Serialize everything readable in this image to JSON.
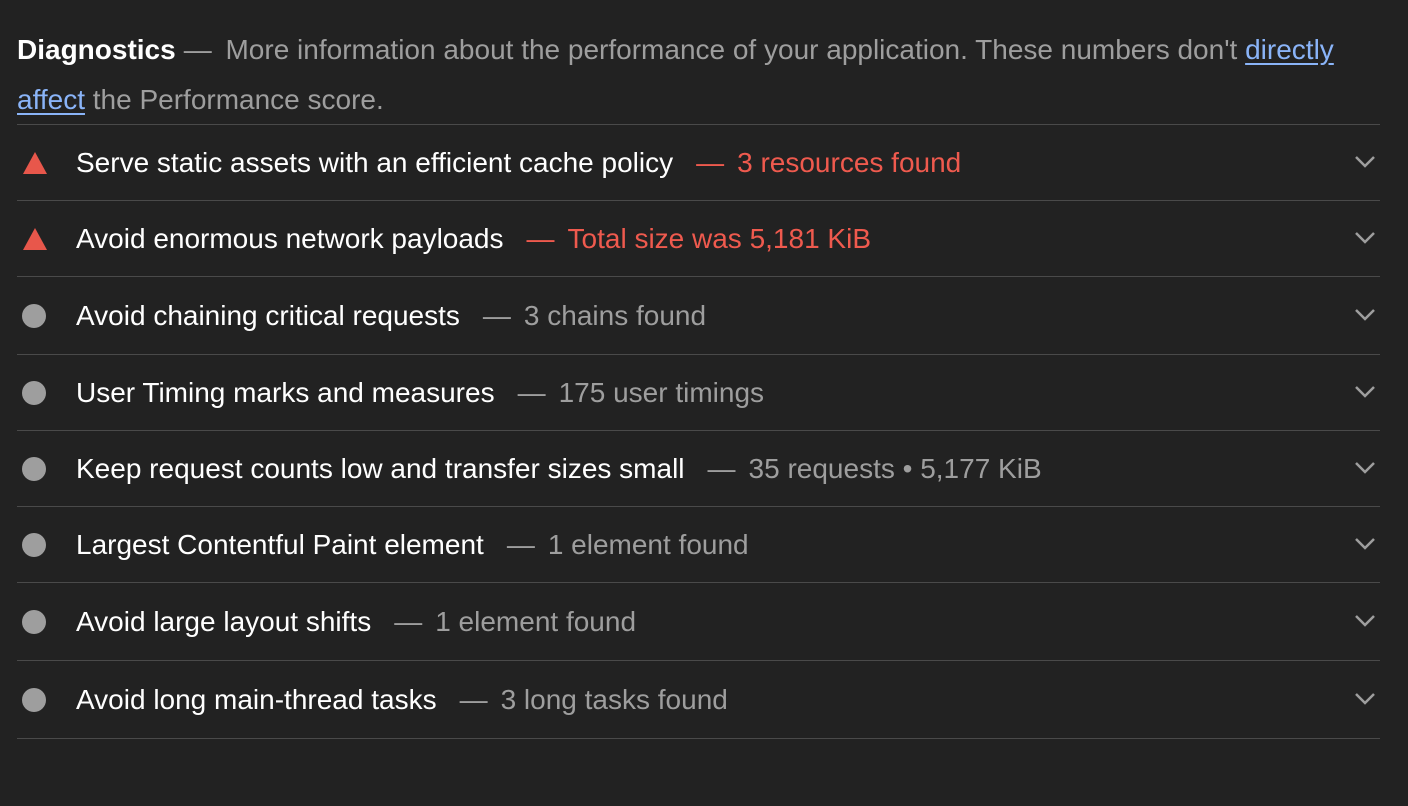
{
  "diagnostics": {
    "title": "Diagnostics",
    "separator": "—",
    "description_before": "More information about the performance of your application. These numbers don't",
    "link_text": "directly affect",
    "description_after": "the Performance score."
  },
  "colors": {
    "background": "#222222",
    "fail": "#ef5a4e",
    "neutral": "#9e9e9e",
    "link": "#8ab4f8"
  },
  "audits": [
    {
      "title": "Serve static assets with an efficient cache policy",
      "dash": "—",
      "display": "3 resources found",
      "status": "fail",
      "icon": "warning-triangle-icon"
    },
    {
      "title": "Avoid enormous network payloads",
      "dash": "—",
      "display": "Total size was 5,181 KiB",
      "status": "fail",
      "icon": "warning-triangle-icon"
    },
    {
      "title": "Avoid chaining critical requests",
      "dash": "—",
      "display": "3 chains found",
      "status": "informative",
      "icon": "gray-circle-icon"
    },
    {
      "title": "User Timing marks and measures",
      "dash": "—",
      "display": "175 user timings",
      "status": "informative",
      "icon": "gray-circle-icon"
    },
    {
      "title": "Keep request counts low and transfer sizes small",
      "dash": "—",
      "display": "35 requests • 5,177 KiB",
      "status": "informative",
      "icon": "gray-circle-icon"
    },
    {
      "title": "Largest Contentful Paint element",
      "dash": "—",
      "display": "1 element found",
      "status": "informative",
      "icon": "gray-circle-icon"
    },
    {
      "title": "Avoid large layout shifts",
      "dash": "—",
      "display": "1 element found",
      "status": "informative",
      "icon": "gray-circle-icon"
    },
    {
      "title": "Avoid long main-thread tasks",
      "dash": "—",
      "display": "3 long tasks found",
      "status": "informative",
      "icon": "gray-circle-icon"
    }
  ]
}
